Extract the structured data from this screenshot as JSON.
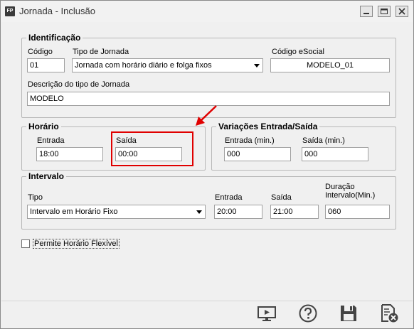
{
  "window": {
    "app_icon_text": "FP",
    "title": "Jornada - Inclusão"
  },
  "identificacao": {
    "legend": "Identificação",
    "codigo_label": "Código",
    "codigo_value": "01",
    "tipo_label": "Tipo de Jornada",
    "tipo_value": "Jornada com horário diário e folga fixos",
    "esocial_label": "Código eSocial",
    "esocial_value": "MODELO_01",
    "descricao_label": "Descrição do tipo de Jornada",
    "descricao_value": "MODELO"
  },
  "horario": {
    "legend": "Horário",
    "entrada_label": "Entrada",
    "entrada_value": "18:00",
    "saida_label": "Saída",
    "saida_value": "00:00"
  },
  "variacoes": {
    "legend": "Variações Entrada/Saída",
    "entrada_label": "Entrada (min.)",
    "entrada_value": "000",
    "saida_label": "Saída (min.)",
    "saida_value": "000"
  },
  "intervalo": {
    "legend": "Intervalo",
    "tipo_label": "Tipo",
    "tipo_value": "Intervalo em Horário Fixo",
    "entrada_label": "Entrada",
    "entrada_value": "20:00",
    "saida_label": "Saída",
    "saida_value": "21:00",
    "duracao_label_line1": "Duração",
    "duracao_label_line2": "Intervalo(Min.)",
    "duracao_value": "060"
  },
  "flexivel": {
    "label": "Permite Horário Flexível",
    "checked": false
  },
  "toolbar": {
    "icons": [
      "preview-icon",
      "help-icon",
      "save-icon",
      "cancel-icon"
    ]
  },
  "colors": {
    "highlight": "#e00000",
    "window_bg": "#f0f0f0"
  }
}
